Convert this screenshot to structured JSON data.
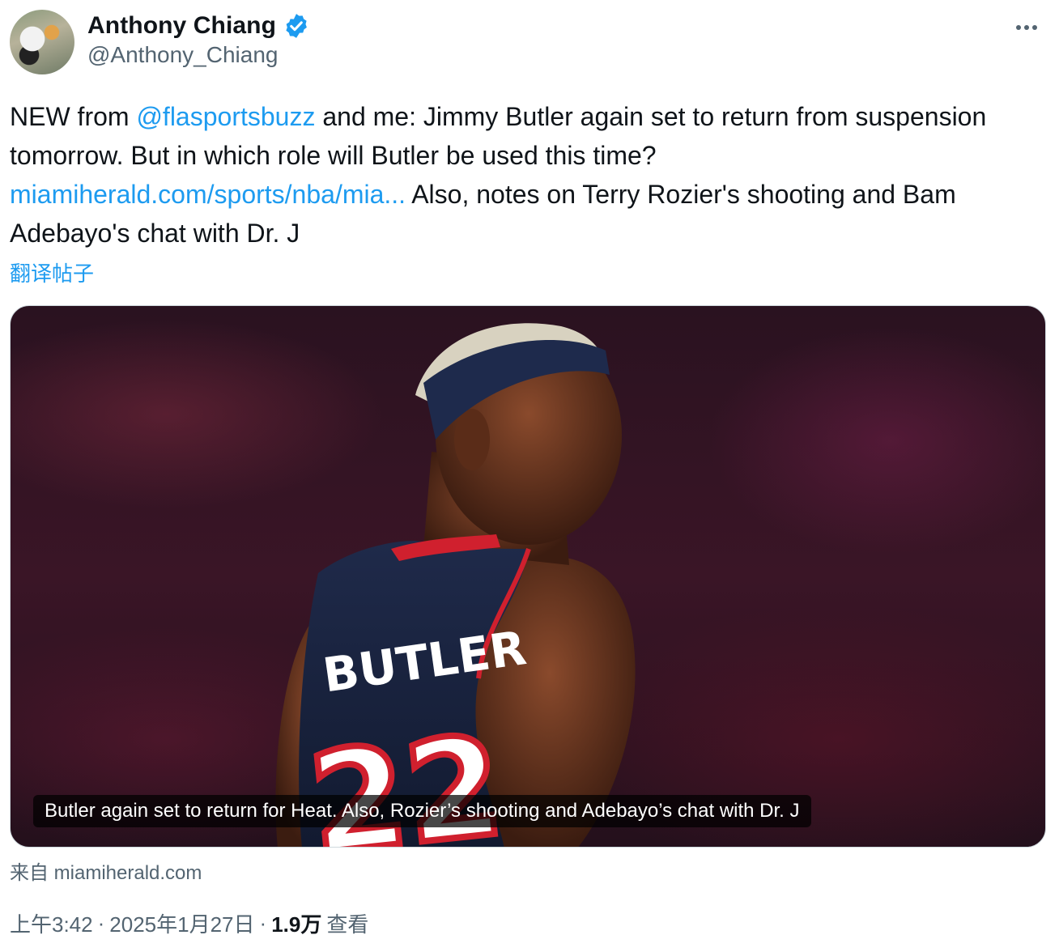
{
  "author": {
    "display_name": "Anthony Chiang",
    "handle": "@Anthony_Chiang",
    "verified_icon": "verified-badge-icon"
  },
  "tweet": {
    "text_1": "NEW from ",
    "mention": "@flasportsbuzz",
    "text_2": " and me: Jimmy Butler again set to return from suspension tomorrow. But in which role will Butler be used this time? ",
    "link": "miamiherald.com/sports/nba/mia...",
    "text_3": " Also, notes on Terry Rozier's shooting and Bam Adebayo's chat with Dr. J",
    "translate_label": "翻译帖子"
  },
  "card": {
    "jersey_name": "BUTLER",
    "jersey_number": "22",
    "caption": "Butler again set to return for Heat. Also, Rozier’s shooting and Adebayo’s chat with Dr. J"
  },
  "source": "来自 miamiherald.com",
  "meta": {
    "time": "上午3:42",
    "separator": "·",
    "date": "2025年1月27日",
    "views_count": "1.9万",
    "views_label": "查看"
  },
  "colors": {
    "link": "#1d9bf0",
    "secondary_text": "#536471",
    "primary_text": "#0f1419",
    "jersey": "#1b2440",
    "jersey_trim": "#d0202e"
  }
}
